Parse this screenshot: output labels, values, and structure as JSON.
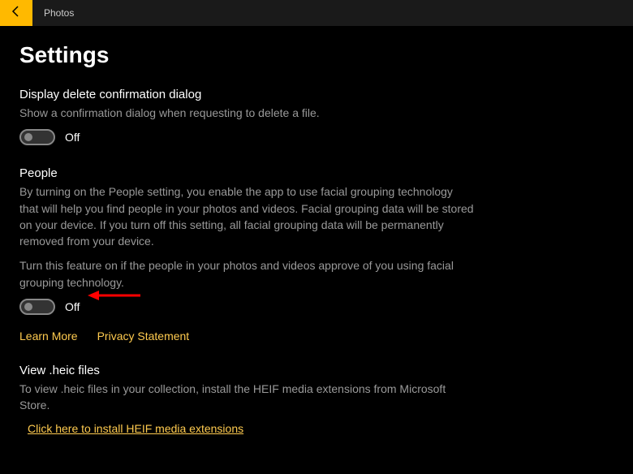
{
  "header": {
    "app_title": "Photos"
  },
  "page": {
    "title": "Settings"
  },
  "sections": {
    "delete_confirm": {
      "title": "Display delete confirmation dialog",
      "desc": "Show a confirmation dialog when requesting to delete a file.",
      "toggle_state": "Off"
    },
    "people": {
      "title": "People",
      "desc": "By turning on the People setting, you enable the app to use facial grouping technology that will help you find people in your photos and videos. Facial grouping data will be stored on your device. If you turn off this setting, all facial grouping data will be permanently removed from your device.",
      "desc2": "Turn this feature on if the people in your photos and videos approve of you using facial grouping technology.",
      "toggle_state": "Off",
      "learn_more": "Learn More",
      "privacy": "Privacy Statement"
    },
    "heic": {
      "title": "View .heic files",
      "desc": "To view .heic files in your collection, install the HEIF media extensions from Microsoft Store.",
      "install_link": "Click here to install HEIF media extensions"
    }
  }
}
